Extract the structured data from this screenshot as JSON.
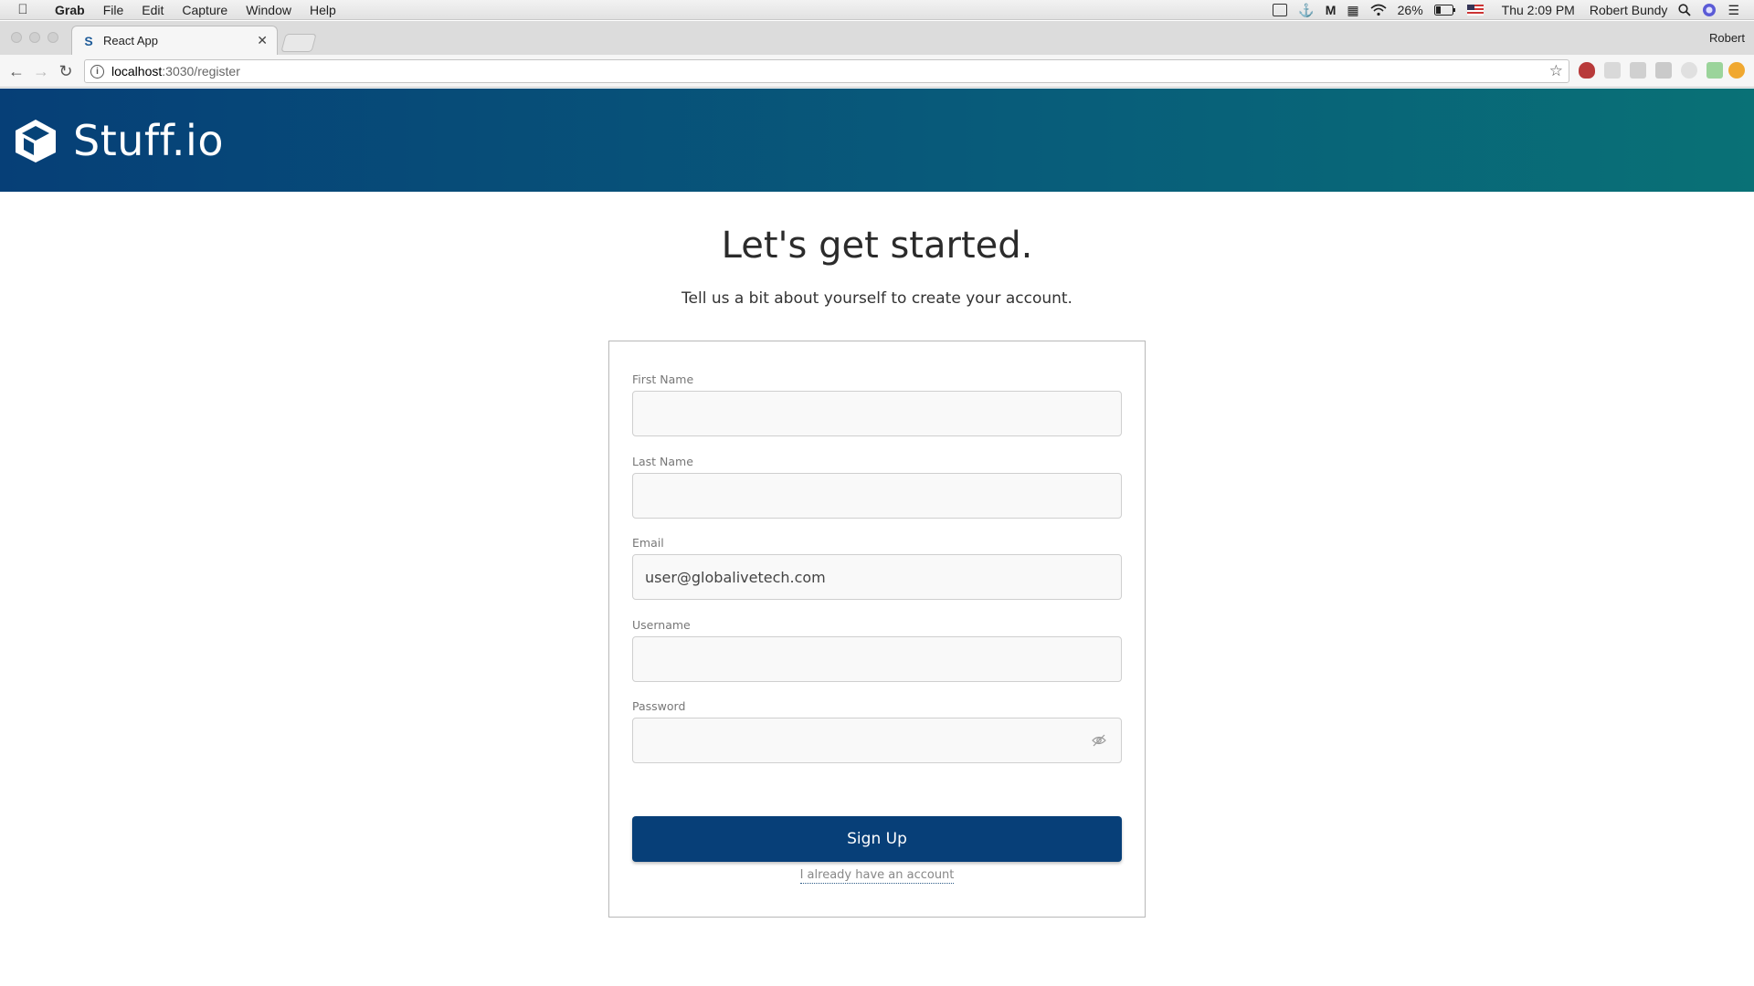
{
  "menubar": {
    "app_name": "Grab",
    "items": [
      "File",
      "Edit",
      "Capture",
      "Window",
      "Help"
    ],
    "battery": "26%",
    "clock": "Thu 2:09 PM",
    "user": "Robert Bundy"
  },
  "browser": {
    "tab_title": "React App",
    "profile_name": "Robert",
    "url_host": "localhost",
    "url_path": ":3030/register"
  },
  "header": {
    "brand": "Stuff.io"
  },
  "page": {
    "title": "Let's get started.",
    "subtitle": "Tell us a bit about yourself to create your account."
  },
  "form": {
    "first_name": {
      "label": "First Name",
      "value": ""
    },
    "last_name": {
      "label": "Last Name",
      "value": ""
    },
    "email": {
      "label": "Email",
      "value": "user@globalivetech.com"
    },
    "username": {
      "label": "Username",
      "value": ""
    },
    "password": {
      "label": "Password",
      "value": ""
    },
    "submit_label": "Sign Up",
    "login_link": "I already have an account"
  },
  "colors": {
    "header_start": "#063f77",
    "header_end": "#097176",
    "primary_button": "#073f78"
  },
  "icons": [
    "apple-icon",
    "wifi-icon",
    "battery-icon",
    "search-icon",
    "star-icon",
    "info-icon",
    "eye-off-icon",
    "cube-logo-icon"
  ]
}
